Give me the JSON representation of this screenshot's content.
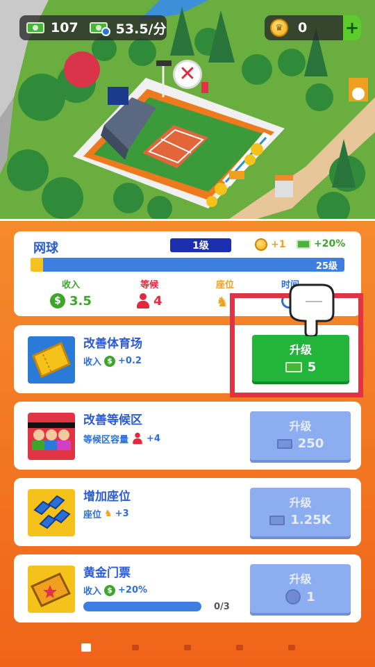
{
  "hud": {
    "money": "107",
    "income_rate": "53.5/分",
    "coins": "0",
    "add_label": "+"
  },
  "scene": {
    "close_label": "✕"
  },
  "facility": {
    "name": "网球",
    "level": "1级",
    "coin_bonus": "+1",
    "cash_bonus": "+20%",
    "progress_fraction": 0.04,
    "max_level": "25级",
    "stats": {
      "income_label": "收入",
      "income_value": "3.5",
      "queue_label": "等候",
      "queue_value": "4",
      "seats_label": "座位",
      "time_label": "时间"
    }
  },
  "upgrades": [
    {
      "title": "改善体育场",
      "desc_label": "收入",
      "desc_value": "+0.2",
      "button_label": "升级",
      "cost": "5",
      "state": "available",
      "icon": "ticket-icon"
    },
    {
      "title": "改善等候区",
      "desc_label": "等候区容量",
      "desc_value": "+4",
      "button_label": "升级",
      "cost": "250",
      "state": "locked",
      "icon": "crowd-icon"
    },
    {
      "title": "增加座位",
      "desc_label": "座位",
      "desc_value": "+3",
      "button_label": "升级",
      "cost": "1.25K",
      "state": "locked",
      "icon": "seats-icon"
    },
    {
      "title": "黄金门票",
      "desc_label": "收入",
      "desc_value": "+20%",
      "button_label": "升级",
      "cost": "1",
      "state": "locked",
      "icon": "golden-ticket-icon",
      "progress_text": "0/3",
      "progress_fraction": 0
    }
  ],
  "pagination": {
    "count": 6,
    "active": 0
  },
  "colors": {
    "panel_orange": "#f26a1b",
    "title_blue": "#2a5bd0",
    "button_green": "#23b43a",
    "button_disabled": "#8cadf0",
    "highlight_red": "#e03344"
  }
}
